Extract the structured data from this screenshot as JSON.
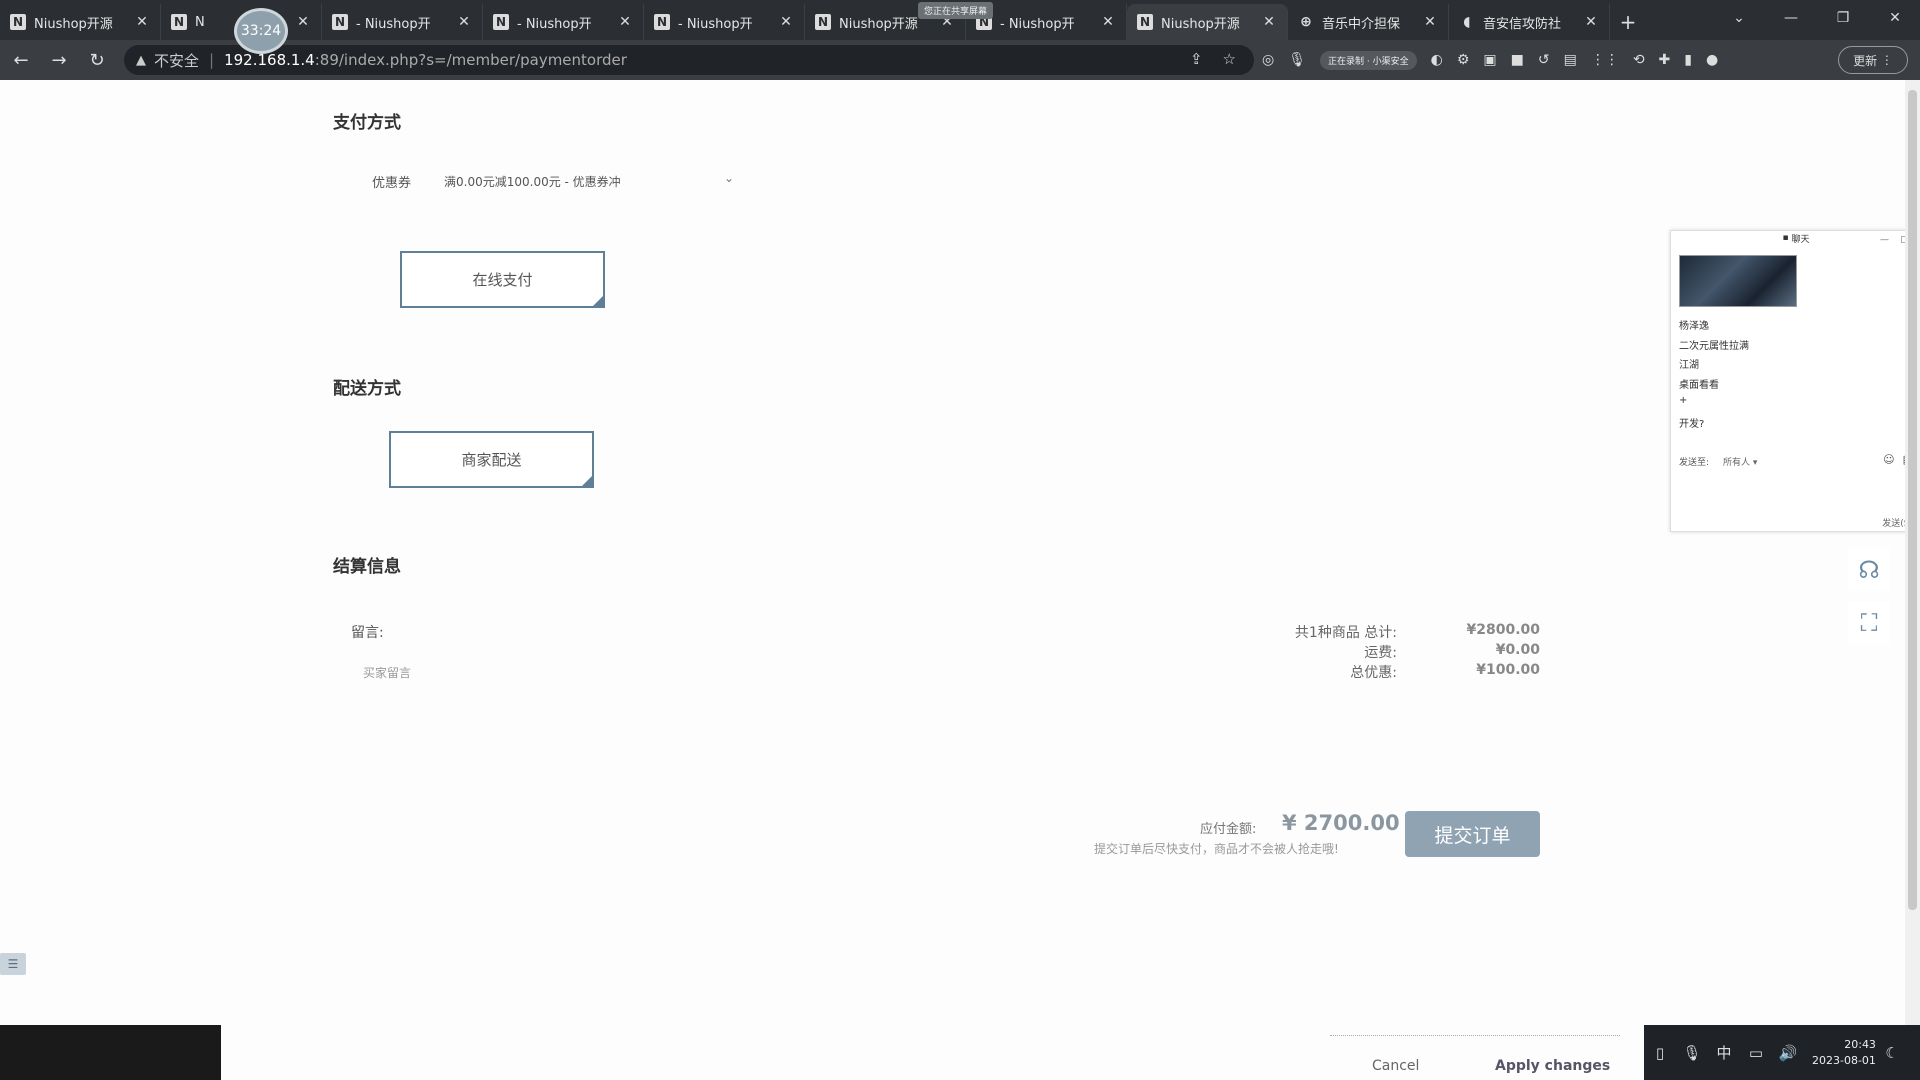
{
  "browser": {
    "tabs": [
      {
        "title": "Niushop开源",
        "favicon": "N",
        "active": false
      },
      {
        "title": "N",
        "favicon": "N",
        "active": false
      },
      {
        "title": "- Niushop开",
        "favicon": "N",
        "active": false
      },
      {
        "title": "- Niushop开",
        "favicon": "N",
        "active": false
      },
      {
        "title": "- Niushop开",
        "favicon": "N",
        "active": false
      },
      {
        "title": "Niushop开源",
        "favicon": "N",
        "active": false
      },
      {
        "title": "- Niushop开",
        "favicon": "N",
        "active": false
      },
      {
        "title": "Niushop开源",
        "favicon": "N",
        "active": true
      },
      {
        "title": "音乐中介担保",
        "favicon": "globe-icon",
        "active": false
      },
      {
        "title": "音安信攻防社",
        "favicon": "shield-icon",
        "active": false
      }
    ],
    "timer": "33:24",
    "share_indicator": "您正在共享屏幕",
    "address": {
      "security_label": "不安全",
      "host": "192.168.1.4",
      "path": ":89/index.php?s=/member/paymentorder"
    },
    "recording_pill": "正在录制 · 小渠安全",
    "update_label": "更新"
  },
  "page": {
    "payment_section": {
      "title": "支付方式",
      "coupon_label": "优惠券",
      "coupon_value": "满0.00元减100.00元 - 优惠券冲",
      "option": "在线支付"
    },
    "delivery_section": {
      "title": "配送方式",
      "option": "商家配送"
    },
    "settlement_section": {
      "title": "结算信息",
      "message_label": "留言:",
      "message_placeholder": "买家留言",
      "summary": [
        {
          "label": "共1种商品 总计:",
          "value": "¥2800.00"
        },
        {
          "label": "运费:",
          "value": "¥0.00"
        },
        {
          "label": "总优惠:",
          "value": "¥100.00"
        }
      ],
      "pay_amount_label": "应付金额:",
      "pay_amount": "¥ 2700.00",
      "pay_note": "提交订单后尽快支付，商品才不会被人抢走哦!",
      "submit_label": "提交订单"
    }
  },
  "chat": {
    "title": "聊天",
    "messages": [
      "杨泽逸",
      "二次元属性拉满",
      "江湖",
      "桌面看看",
      "+",
      "开发?"
    ],
    "send_to_label": "发送至:",
    "recipient": "所有人",
    "send_label": "发送(S)"
  },
  "dialog_footer": {
    "cancel_label": "Cancel",
    "apply_label": "Apply changes"
  },
  "taskbar": {
    "ime": "中",
    "time": "20:43",
    "date": "2023-08-01"
  },
  "colors": {
    "accent": "#5f7f97",
    "submit_bg": "#8fa3b3",
    "chrome_dark": "#2b2f33"
  }
}
